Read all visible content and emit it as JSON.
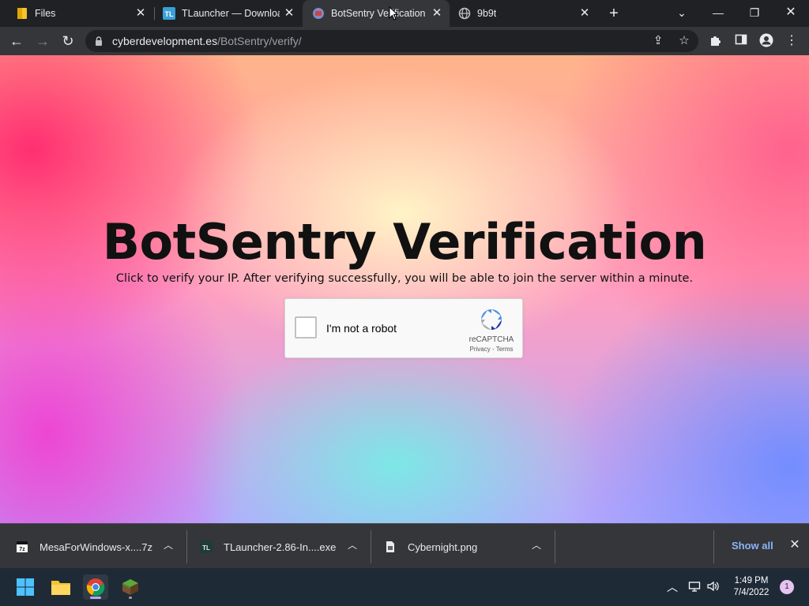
{
  "browser": {
    "tabs": [
      {
        "title": "Files",
        "icon": "folder-icon"
      },
      {
        "title": "TLauncher — Downloa",
        "icon": "tlauncher-icon"
      },
      {
        "title": "BotSentry Verification",
        "icon": "botsentry-icon",
        "active": true
      },
      {
        "title": "9b9t",
        "icon": "globe-icon"
      }
    ],
    "url_host": "cyberdevelopment.es",
    "url_path": "/BotSentry/verify/"
  },
  "page": {
    "heading": "BotSentry Verification",
    "subtitle": "Click to verify your IP. After verifying successfully, you will be able to join the server within a minute.",
    "recaptcha": {
      "label": "I'm not a robot",
      "brand": "reCAPTCHA",
      "privacy": "Privacy",
      "separator": " - ",
      "terms": "Terms"
    }
  },
  "downloads": {
    "items": [
      {
        "name": "MesaForWindows-x....7z",
        "icon": "archive-7z-icon"
      },
      {
        "name": "TLauncher-2.86-In....exe",
        "icon": "tlauncher-icon"
      },
      {
        "name": "Cybernight.png",
        "icon": "image-file-icon"
      }
    ],
    "show_all": "Show all"
  },
  "taskbar": {
    "time": "1:49 PM",
    "date": "7/4/2022",
    "notification_count": "1"
  },
  "colors": {
    "tab_strip": "#202124",
    "toolbar": "#35363a",
    "link_blue": "#8ab4f8",
    "taskbar": "#1f2a37"
  }
}
